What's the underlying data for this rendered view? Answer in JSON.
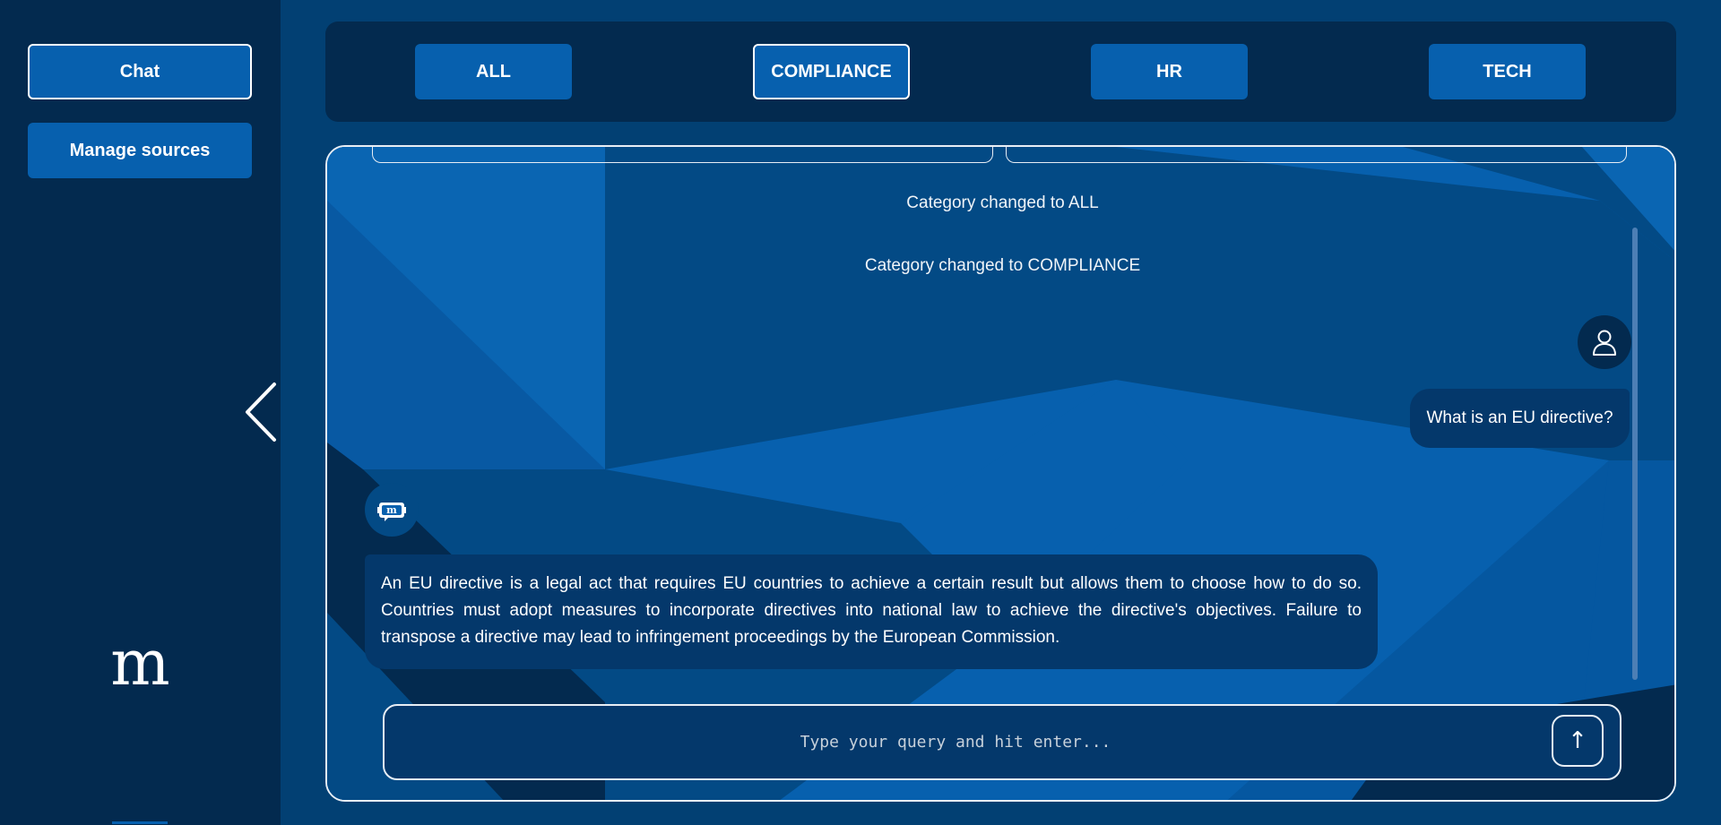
{
  "sidebar": {
    "chat_label": "Chat",
    "manage_sources_label": "Manage sources",
    "logo_text": "m"
  },
  "categories": {
    "items": [
      {
        "label": "ALL",
        "active": false
      },
      {
        "label": "COMPLIANCE",
        "active": true
      },
      {
        "label": "HR",
        "active": false
      },
      {
        "label": "TECH",
        "active": false
      }
    ]
  },
  "chat": {
    "system_messages": [
      "Category changed to ALL",
      "Category changed to COMPLIANCE"
    ],
    "user_message": "What is an EU directive?",
    "bot_message": "An EU directive is a legal act that requires EU countries to achieve a certain result but allows them to choose how to do so. Countries must adopt measures to incorporate directives into national law to achieve the directive's objectives. Failure to transpose a directive may lead to infringement proceedings by the European Commission.",
    "input_placeholder": "Type your query and hit enter...",
    "input_value": "",
    "send_icon": "↑"
  },
  "icons": {
    "collapse": "chevron-left-icon",
    "user_avatar": "user-icon",
    "bot_avatar": "bot-logo-icon",
    "send": "arrow-up-icon"
  },
  "colors": {
    "background": "#024073",
    "sidebar": "#032a4f",
    "button": "#0760ae",
    "bubble": "#04386b",
    "border": "#e8eef5"
  }
}
